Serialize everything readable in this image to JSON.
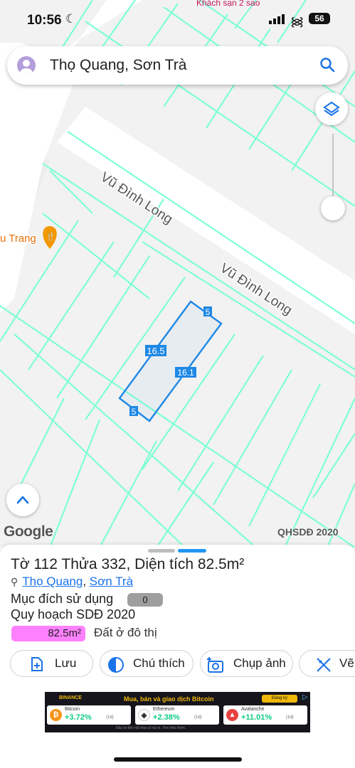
{
  "status_bar": {
    "time": "10:56",
    "battery": "56",
    "top_place": "Khách sạn 2 sao"
  },
  "search": {
    "query": "Thọ Quang, Sơn Trà"
  },
  "map": {
    "street_label_1": "Vũ Đình Long",
    "street_label_2": "Vũ Đình Long",
    "poi_partial": "u Trang",
    "parcel_dims": {
      "long_side": "16.5",
      "short_side_top": "5",
      "short_side_bottom": "5",
      "center_label": "16.1"
    },
    "google_logo": "Google",
    "layer_label": "QHSDĐ 2020"
  },
  "parcel": {
    "title": "Tờ 112 Thửa 332, Diện tích 82.5m²",
    "ward": "Thọ Quang",
    "district": "Sơn Trà",
    "comma": ",",
    "purpose_label": "Mục đích sử dụng",
    "purpose_count": "0",
    "planning_label": "Quy hoạch SDĐ 2020",
    "area_value": "82.5m²",
    "land_type": "Đất ở đô thị"
  },
  "actions": [
    {
      "label": "Lưu",
      "icon": "add-document-icon"
    },
    {
      "label": "Chú thích",
      "icon": "contrast-icon"
    },
    {
      "label": "Chụp ảnh",
      "icon": "camera-icon"
    },
    {
      "label": "Vẽ",
      "icon": "ruler-pencil-icon"
    }
  ],
  "ad": {
    "brand": "BINANCE",
    "headline": "Mua, bán và giao dịch Bitcoin",
    "cta": "Đăng ký",
    "footer": "Đầu tư tiền mã hóa có rủi ro. Tìm hiểu thêm.",
    "coins": [
      {
        "name": "Bitcoin",
        "change": "+3.72%",
        "period": "(1d)",
        "symbol": "₿"
      },
      {
        "name": "Ethereum",
        "change": "+2.38%",
        "period": "(1d)",
        "symbol": "◆"
      },
      {
        "name": "Avalanche",
        "change": "+11.01%",
        "period": "(1d)",
        "symbol": "▲"
      }
    ]
  },
  "colors": {
    "parcel_line": "#1e88e5",
    "cadastral_line": "#7fffd4",
    "land_fill": "#ff80ff",
    "link": "#1a73e8",
    "accent": "#2196f3"
  }
}
